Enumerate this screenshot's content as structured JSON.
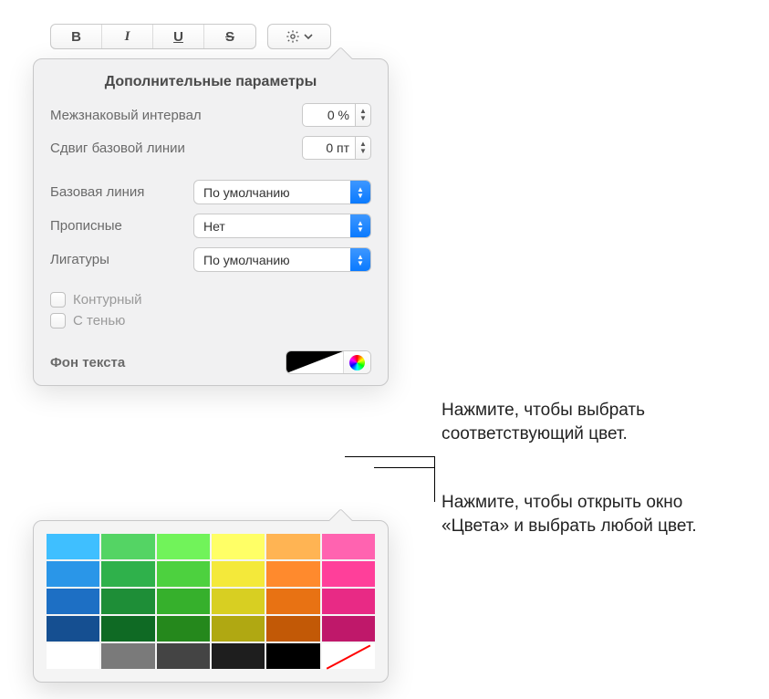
{
  "toolbar": {
    "bold_label": "B",
    "italic_label": "I",
    "underline_label": "U",
    "strike_label": "S"
  },
  "popover": {
    "title": "Дополнительные параметры",
    "character_spacing_label": "Межзнаковый интервал",
    "character_spacing_value": "0 %",
    "baseline_shift_label": "Сдвиг базовой линии",
    "baseline_shift_value": "0 пт",
    "baseline_label": "Базовая линия",
    "baseline_value": "По умолчанию",
    "capitalization_label": "Прописные",
    "capitalization_value": "Нет",
    "ligatures_label": "Лигатуры",
    "ligatures_value": "По умолчанию",
    "outline_checkbox_label": "Контурный",
    "shadow_checkbox_label": "С тенью",
    "text_background_label": "Фон текста"
  },
  "callouts": {
    "well": "Нажмите, чтобы выбрать соответствующий цвет.",
    "wheel": "Нажмите, чтобы открыть окно «Цвета» и выбрать любой цвет."
  },
  "palette": {
    "rows": [
      [
        "#3fbfff",
        "#54d464",
        "#71f35a",
        "#ffff66",
        "#ffb453",
        "#ff63b0"
      ],
      [
        "#2a96e8",
        "#2fb14b",
        "#4dd13f",
        "#f4e93a",
        "#ff8a2d",
        "#ff3f9a"
      ],
      [
        "#1d6fc4",
        "#1e8e37",
        "#36b02c",
        "#d8cf22",
        "#e87213",
        "#e82a85"
      ],
      [
        "#154f91",
        "#0f6a24",
        "#25881c",
        "#b0a812",
        "#c25906",
        "#bf186a"
      ],
      [
        "#ffffff",
        "#7a7a7a",
        "#444444",
        "#1e1e1e",
        "#000000",
        "none"
      ]
    ]
  }
}
